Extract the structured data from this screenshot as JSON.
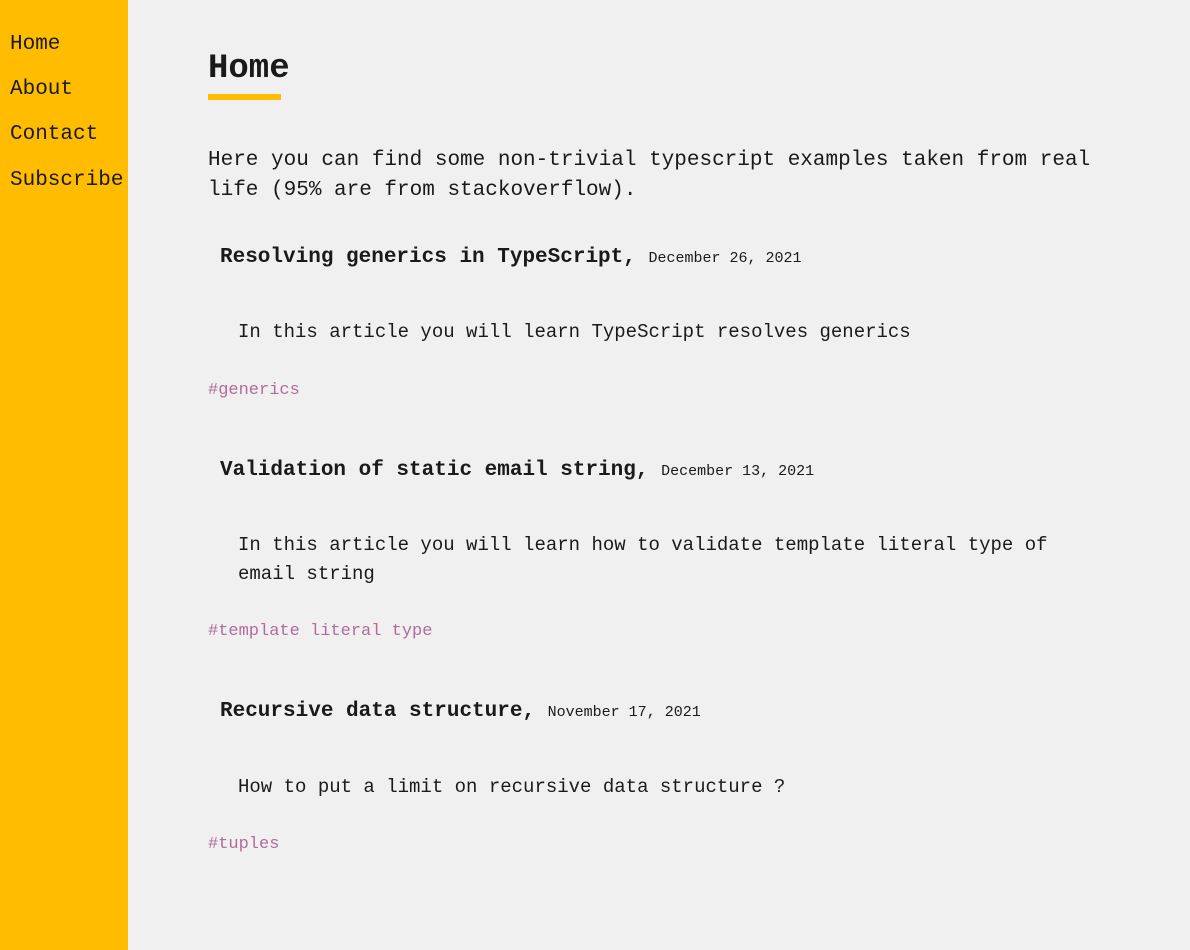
{
  "sidebar": {
    "items": [
      {
        "label": "Home"
      },
      {
        "label": "About"
      },
      {
        "label": "Contact"
      },
      {
        "label": "Subscribe"
      }
    ]
  },
  "page": {
    "title": "Home",
    "intro": "Here you can find some non-trivial typescript examples taken from real life (95% are from stackoverflow)."
  },
  "articles": [
    {
      "title": "Resolving generics in TypeScript,",
      "date": "December 26, 2021",
      "desc": "In this article you will learn TypeScript resolves generics",
      "tag": "#generics"
    },
    {
      "title": "Validation of static email string,",
      "date": "December 13, 2021",
      "desc": "In this article you will learn how to validate template literal type of email string",
      "tag": "#template literal type"
    },
    {
      "title": "Recursive data structure,",
      "date": "November 17, 2021",
      "desc": "How to put a limit on recursive data structure ?",
      "tag": "#tuples"
    }
  ]
}
